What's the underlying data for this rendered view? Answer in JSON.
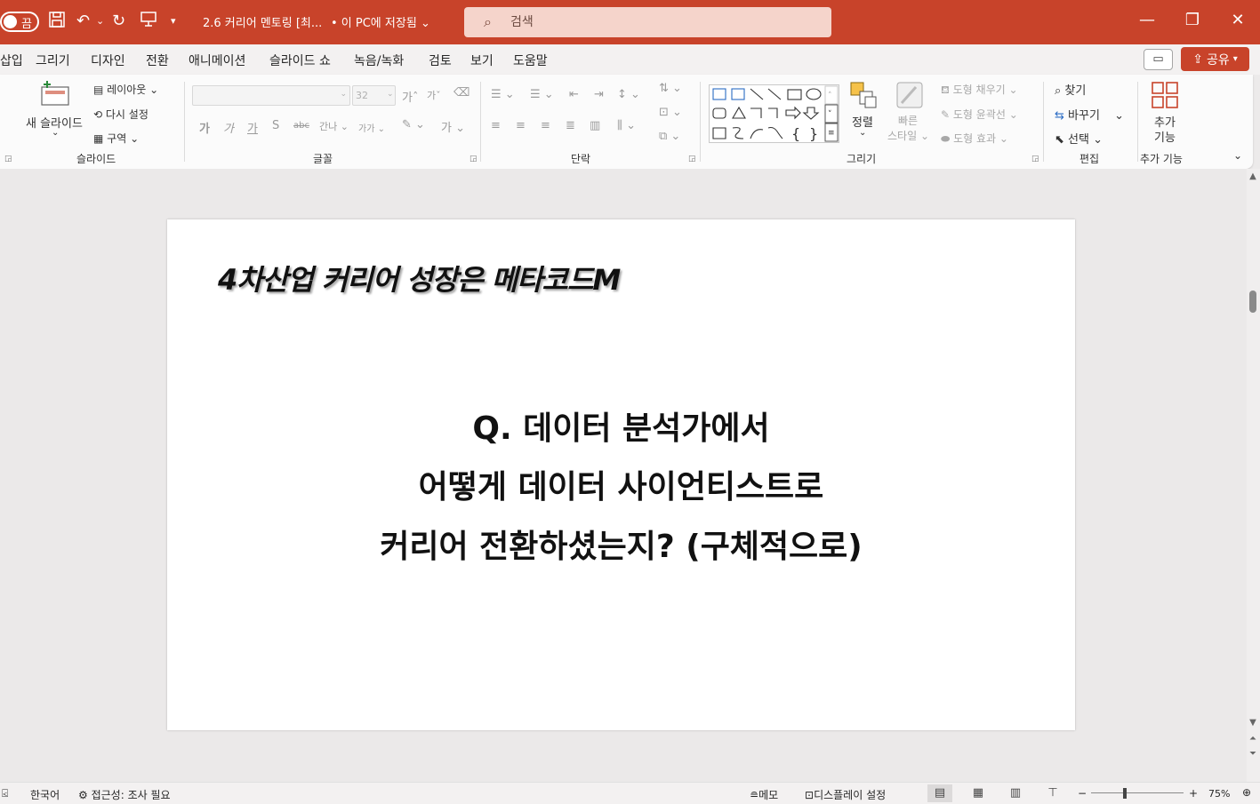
{
  "titlebar": {
    "autosave_label": "끔",
    "doc_title": "2.6 커리어 멘토링 [최...",
    "save_status": "• 이 PC에 저장됨",
    "search_placeholder": "검색",
    "bg_color": "#c8432a"
  },
  "menu": {
    "items": [
      "삽입",
      "그리기",
      "디자인",
      "전환",
      "애니메이션",
      "슬라이드 쇼",
      "녹음/녹화",
      "검토",
      "보기",
      "도움말"
    ],
    "share_label": "공유"
  },
  "ribbon": {
    "slides": {
      "new_slide": "새 슬라이드",
      "layout": "레이아웃",
      "reset": "다시 설정",
      "section": "구역",
      "group": "슬라이드"
    },
    "font": {
      "size": "32",
      "group": "글꼴",
      "grow": "가",
      "shrink": "가",
      "clear": "가",
      "bold": "가",
      "italic": "가",
      "underline": "가",
      "strike": "S",
      "strike2": "abc",
      "spacing": "간나",
      "case": "가가",
      "color": "가"
    },
    "paragraph": {
      "group": "단락"
    },
    "drawing": {
      "arrange": "정렬",
      "quick_styles_1": "빠른",
      "quick_styles_2": "스타일",
      "fill": "도형 채우기",
      "outline": "도형 윤곽선",
      "effects": "도형 효과",
      "group": "그리기"
    },
    "editing": {
      "find": "찾기",
      "replace": "바꾸기",
      "select": "선택",
      "group": "편집"
    },
    "addins": {
      "label_1": "추가",
      "label_2": "기능",
      "group": "추가 기능"
    }
  },
  "slide": {
    "title": "4차산업 커리어 성장은 메타코드M",
    "question_lines": [
      "Q. 데이터 분석가에서",
      "어떻게 데이터 사이언티스트로",
      "커리어 전환하셨는지? (구체적으로)"
    ]
  },
  "status": {
    "language": "한국어",
    "accessibility": "접근성: 조사 필요",
    "notes": "메모",
    "display_settings": "디스플레이 설정",
    "zoom": "75%"
  }
}
